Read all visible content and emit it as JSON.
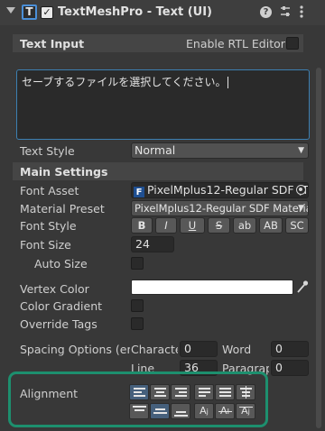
{
  "component": {
    "title": "TextMeshPro - Text (UI)",
    "icon_letter": "T",
    "enabled_check": "✓"
  },
  "header_icons": [
    "help-icon",
    "preset-icon",
    "more-icon"
  ],
  "text_input": {
    "section_label": "Text Input",
    "rtl_label": "Enable RTL Editor",
    "value": "セーブするファイルを選択してください。",
    "text_style_label": "Text Style",
    "text_style_value": "Normal"
  },
  "main_settings": {
    "section_label": "Main Settings",
    "font_asset_label": "Font Asset",
    "font_asset_value": "PixelMplus12-Regular SDF (T",
    "material_preset_label": "Material Preset",
    "material_preset_value": "PixelMplus12-Regular SDF Materia",
    "font_style_label": "Font Style",
    "font_style_buttons": [
      "B",
      "I",
      "U",
      "S",
      "ab",
      "AB",
      "SC"
    ],
    "font_size_label": "Font Size",
    "font_size_value": "24",
    "auto_size_label": "Auto Size",
    "vertex_color_label": "Vertex Color",
    "vertex_color": "#ffffff",
    "color_gradient_label": "Color Gradient",
    "override_tags_label": "Override Tags",
    "spacing_label": "Spacing Options (em",
    "character_label": "Characte",
    "character_value": "0",
    "word_label": "Word",
    "word_value": "0",
    "line_label": "Line",
    "line_value": "36",
    "paragraph_label": "Paragrap",
    "paragraph_value": "0",
    "alignment_label": "Alignment",
    "horizontal_alignment_selected": "left",
    "vertical_alignment_selected": "middle"
  },
  "colors": {
    "accent": "#3c7fb1",
    "highlight_box": "#1d8f6e"
  }
}
